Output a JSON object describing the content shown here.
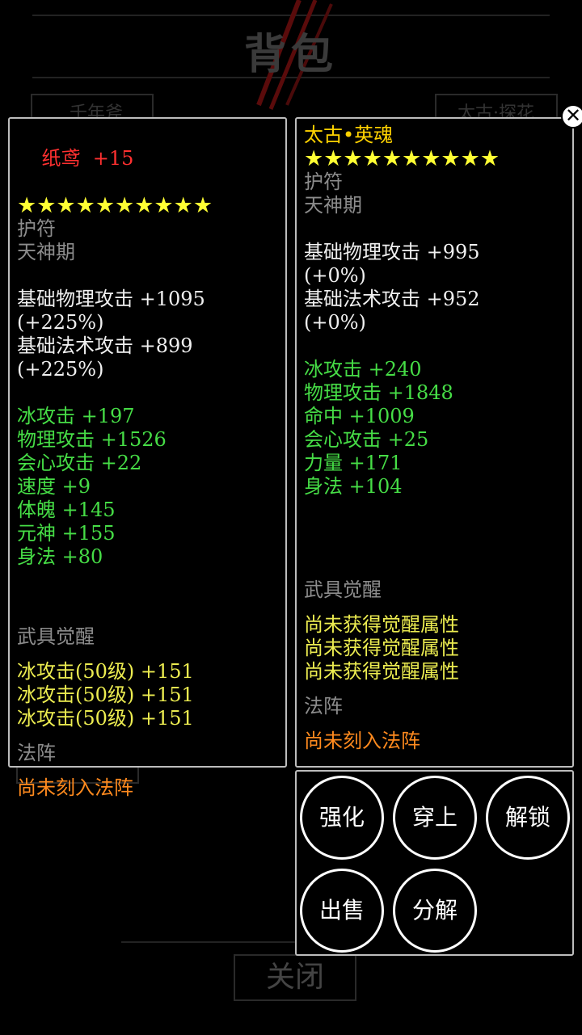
{
  "background": {
    "title": "背包",
    "card_left": "千年斧",
    "card_right": "太古·探花",
    "close_label": "关闭"
  },
  "left_item": {
    "name": "纸鸢",
    "level": "+15",
    "stars": "★★★★★★★★★★",
    "type": "护符",
    "stage": "天神期",
    "base_stats": [
      "基础物理攻击 +1095",
      "(+225%)",
      "基础法术攻击 +899",
      "(+225%)"
    ],
    "bonus_stats": [
      "冰攻击 +197",
      "物理攻击 +1526",
      "会心攻击 +22",
      "速度 +9",
      "体魄 +145",
      "元神 +155",
      "身法 +80"
    ],
    "awaken_label": "武具觉醒",
    "awaken_stats": [
      "冰攻击(50级) +151",
      "冰攻击(50级) +151",
      "冰攻击(50级) +151"
    ],
    "array_label": "法阵",
    "array_value": "尚未刻入法阵"
  },
  "right_item": {
    "name": "太古•英魂",
    "stars": "★★★★★★★★★★",
    "type": "护符",
    "stage": "天神期",
    "base_stats": [
      "基础物理攻击 +995",
      "(+0%)",
      "基础法术攻击 +952",
      "(+0%)"
    ],
    "bonus_stats": [
      "冰攻击 +240",
      "物理攻击 +1848",
      "命中 +1009",
      "会心攻击 +25",
      "力量 +171",
      "身法 +104"
    ],
    "awaken_label": "武具觉醒",
    "awaken_stats": [
      "尚未获得觉醒属性",
      "尚未获得觉醒属性",
      "尚未获得觉醒属性"
    ],
    "array_label": "法阵",
    "array_value": "尚未刻入法阵"
  },
  "actions": {
    "enhance": "强化",
    "equip": "穿上",
    "unlock": "解锁",
    "sell": "出售",
    "decompose": "分解"
  },
  "close_icon": "close-icon"
}
